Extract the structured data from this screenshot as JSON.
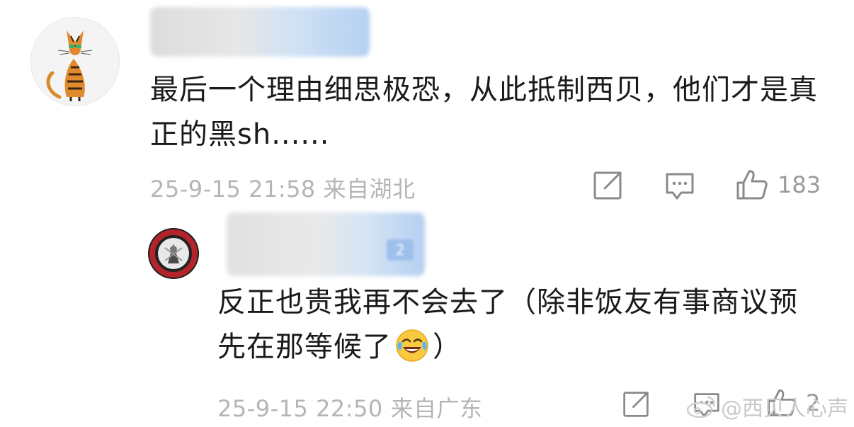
{
  "comments": [
    {
      "text": "最后一个理由细思极恐，从此抵制西贝，他们才是真正的黑sh......",
      "time": "25-9-15 21:58",
      "location": "来自湖北",
      "likes": "183",
      "avatar_icon": "cat-cartoon-avatar",
      "icons": [
        "share-icon",
        "comment-icon",
        "like-icon"
      ]
    },
    {
      "text_before_emoji": "反正也贵我再不会去了（除非饭友有事商议预先在那等候了",
      "emoji_icon": "crying-laughing-emoji",
      "text_after_emoji": "）",
      "time": "25-9-15 22:50",
      "location": "来自广东",
      "likes": "2",
      "avatar_icon": "badge-logo-avatar",
      "name_badge_text": "2",
      "icons": [
        "share-icon",
        "comment-icon",
        "like-icon"
      ]
    }
  ],
  "watermark": {
    "text": "@西贝人心声",
    "icon": "weibo-logo"
  },
  "colors": {
    "text": "#1a1a1a",
    "meta": "#b5b5b5",
    "icon": "#8a8a8a",
    "blur_blue": "#a9c9ef"
  }
}
